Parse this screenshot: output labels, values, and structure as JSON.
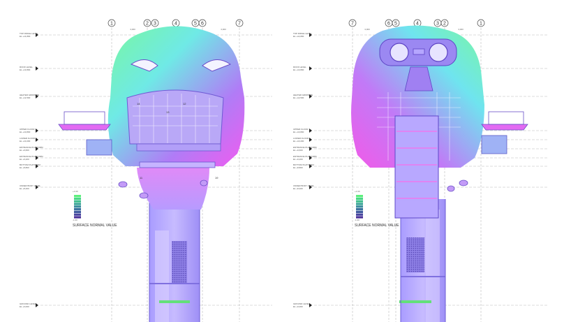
{
  "sheets": [
    {
      "id": "left",
      "grid_labels": [
        "1",
        "2",
        "3",
        "4",
        "5",
        "6",
        "7"
      ],
      "dimension_labels": [
        "3,000",
        "3,000",
        "3,000"
      ],
      "level_labels": [
        [
          "TOP RIDGE LEVEL",
          "EL +14,800"
        ],
        [
          "ROOF LEVEL",
          "EL +13,800"
        ],
        [
          "HEATER GRIDWIRE",
          "EL +12,500"
        ],
        [
          "UPPER FLOOR",
          "EL +10,800"
        ],
        [
          "LOWER FLOOR",
          "EL +10,200"
        ],
        [
          "ENTRANCE PLATFORM",
          "EL +9,600"
        ],
        [
          "ENTRANCE PLATFORM",
          "EL +9,200"
        ],
        [
          "BOTTOM PLATFORM",
          "EL +8,800"
        ],
        [
          "UNDER BODY LEVEL",
          "EL +8,400"
        ],
        [
          "GROUND LEVEL",
          "EL +0,000"
        ]
      ],
      "tags": [
        "14",
        "12",
        "13",
        "11",
        "19"
      ],
      "legend": {
        "top": "+1.00",
        "bottom": "-1.00",
        "title": "SURFACE NORMAL VALUE",
        "swatches": [
          "#5cf07c",
          "#4ad886",
          "#3fbe8e",
          "#3aa596",
          "#3a8c9c",
          "#3c739f",
          "#405ba0",
          "#46449e",
          "#4b3098"
        ]
      }
    },
    {
      "id": "right",
      "grid_labels": [
        "7",
        "6",
        "5",
        "4",
        "3",
        "2",
        "1"
      ],
      "dimension_labels": [
        "3,000",
        "3,000",
        "3,000"
      ],
      "level_labels": [
        [
          "TOP RIDGE LEVEL",
          "EL +14,800"
        ],
        [
          "ROOF LEVEL",
          "EL +13,800"
        ],
        [
          "HEATER GRIDWIRE",
          "EL +12,500"
        ],
        [
          "UPPER FLOOR",
          "EL +10,800"
        ],
        [
          "LOWER FLOOR",
          "EL +10,200"
        ],
        [
          "ENTRANCE PLATFORM",
          "EL +9,600"
        ],
        [
          "ENTRANCE PLATFORM",
          "EL +9,200"
        ],
        [
          "BOTTOM PLATFORM",
          "EL +8,800"
        ],
        [
          "UNDER BODY LEVEL",
          "EL +8,400"
        ],
        [
          "GROUND LEVEL",
          "EL +0,000"
        ]
      ],
      "tags": [],
      "legend": {
        "top": "+1.00",
        "bottom": "-1.00",
        "title": "SURFACE NORMAL VALUE",
        "swatches": [
          "#5cf07c",
          "#4ad886",
          "#3fbe8e",
          "#3aa596",
          "#3a8c9c",
          "#3c739f",
          "#405ba0",
          "#46449e",
          "#4b3098"
        ]
      }
    }
  ],
  "colors": {
    "tower": "#b7a6ff",
    "tower_dark": "#8c7ef0",
    "head_top": "#5ff2b6",
    "head_side": "#e85cf2",
    "head_mid": "#8ad1ff",
    "deck": "#c49af7",
    "green_band": "#60e070",
    "grid_line": "#b8b8b8"
  }
}
